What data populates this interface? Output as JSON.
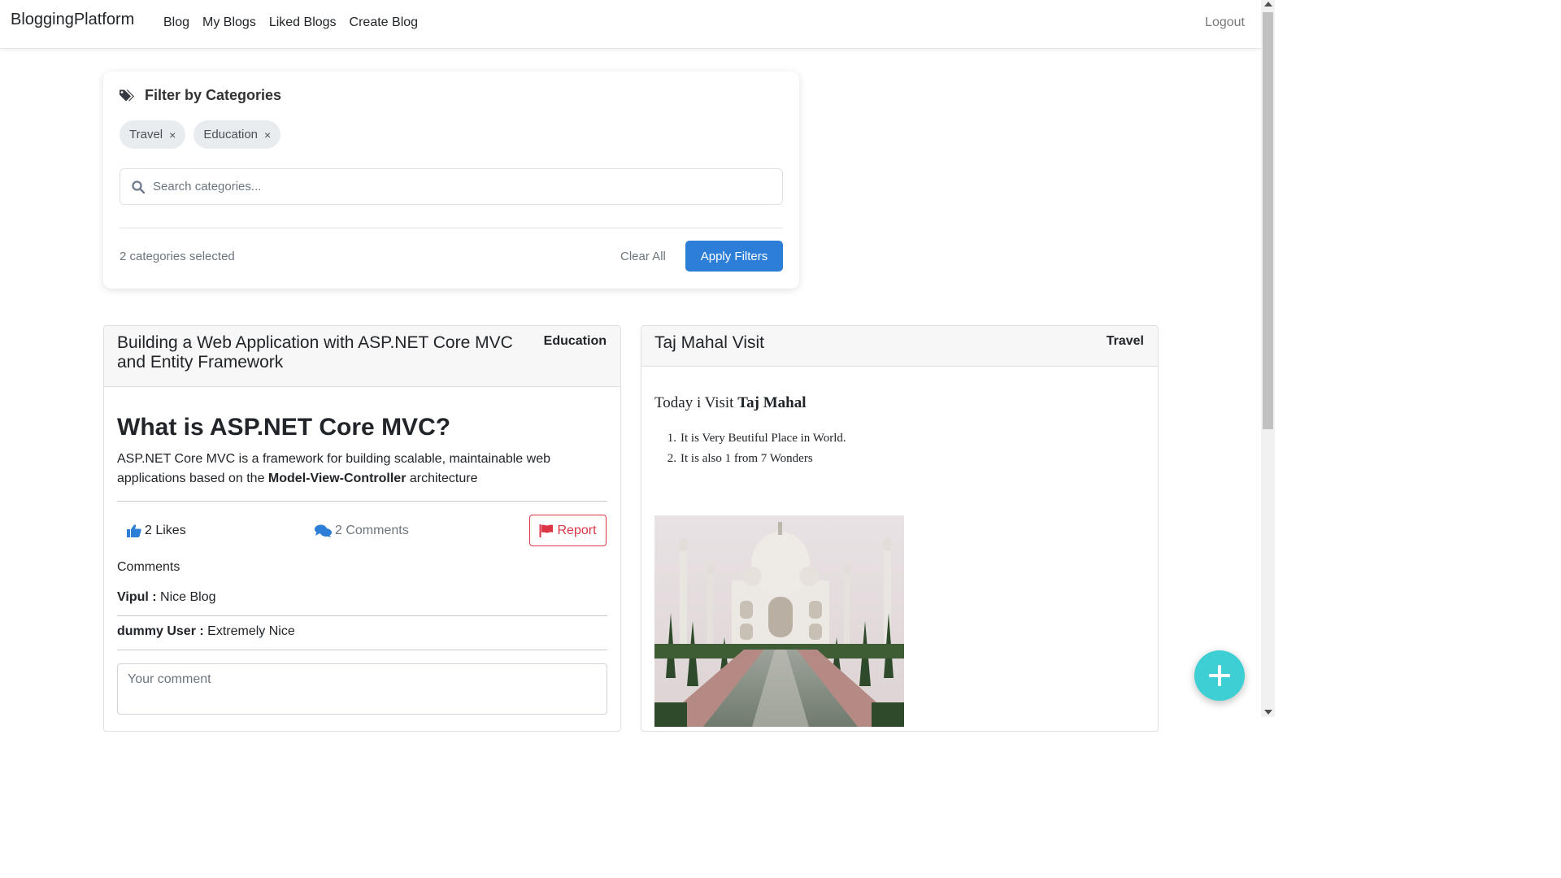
{
  "navbar": {
    "brand": "BloggingPlatform",
    "links": [
      "Blog",
      "My Blogs",
      "Liked Blogs",
      "Create Blog"
    ],
    "logout": "Logout"
  },
  "filter": {
    "title": "Filter by Categories",
    "icon": "tags-icon",
    "chips": [
      "Travel",
      "Education"
    ],
    "chip_remove": "×",
    "search_placeholder": "Search categories...",
    "selected_text": "2 categories selected",
    "clear_all": "Clear All",
    "apply": "Apply Filters",
    "accent_color": "#2d7ed6"
  },
  "posts": [
    {
      "title": "Building a Web Application with ASP.NET Core MVC and Entity Framework",
      "category": "Education",
      "heading": "What is ASP.NET Core MVC?",
      "body_pre": "ASP.NET Core MVC is a framework for building scalable, maintainable web applications based on the ",
      "body_bold": "Model-View-Controller",
      "body_post": " architecture",
      "likes": "2 Likes",
      "comments_count": "2 Comments",
      "report": "Report",
      "comments_heading": "Comments",
      "comments": [
        {
          "author": "Vipul :",
          "text": " Nice Blog"
        },
        {
          "author": "dummy User :",
          "text": " Extremely Nice"
        }
      ],
      "comment_placeholder": "Your comment"
    },
    {
      "title": "Taj Mahal Visit",
      "category": "Travel",
      "lead_pre": "Today i Visit ",
      "lead_bold": "Taj Mahal",
      "list": [
        {
          "num": "1.",
          "text": "It is Very Beutiful Place in World."
        },
        {
          "num": "2.",
          "text": "It is also 1 from 7 Wonders"
        }
      ]
    }
  ],
  "fab": {
    "icon": "plus-icon",
    "color": "#3ecfd4"
  }
}
